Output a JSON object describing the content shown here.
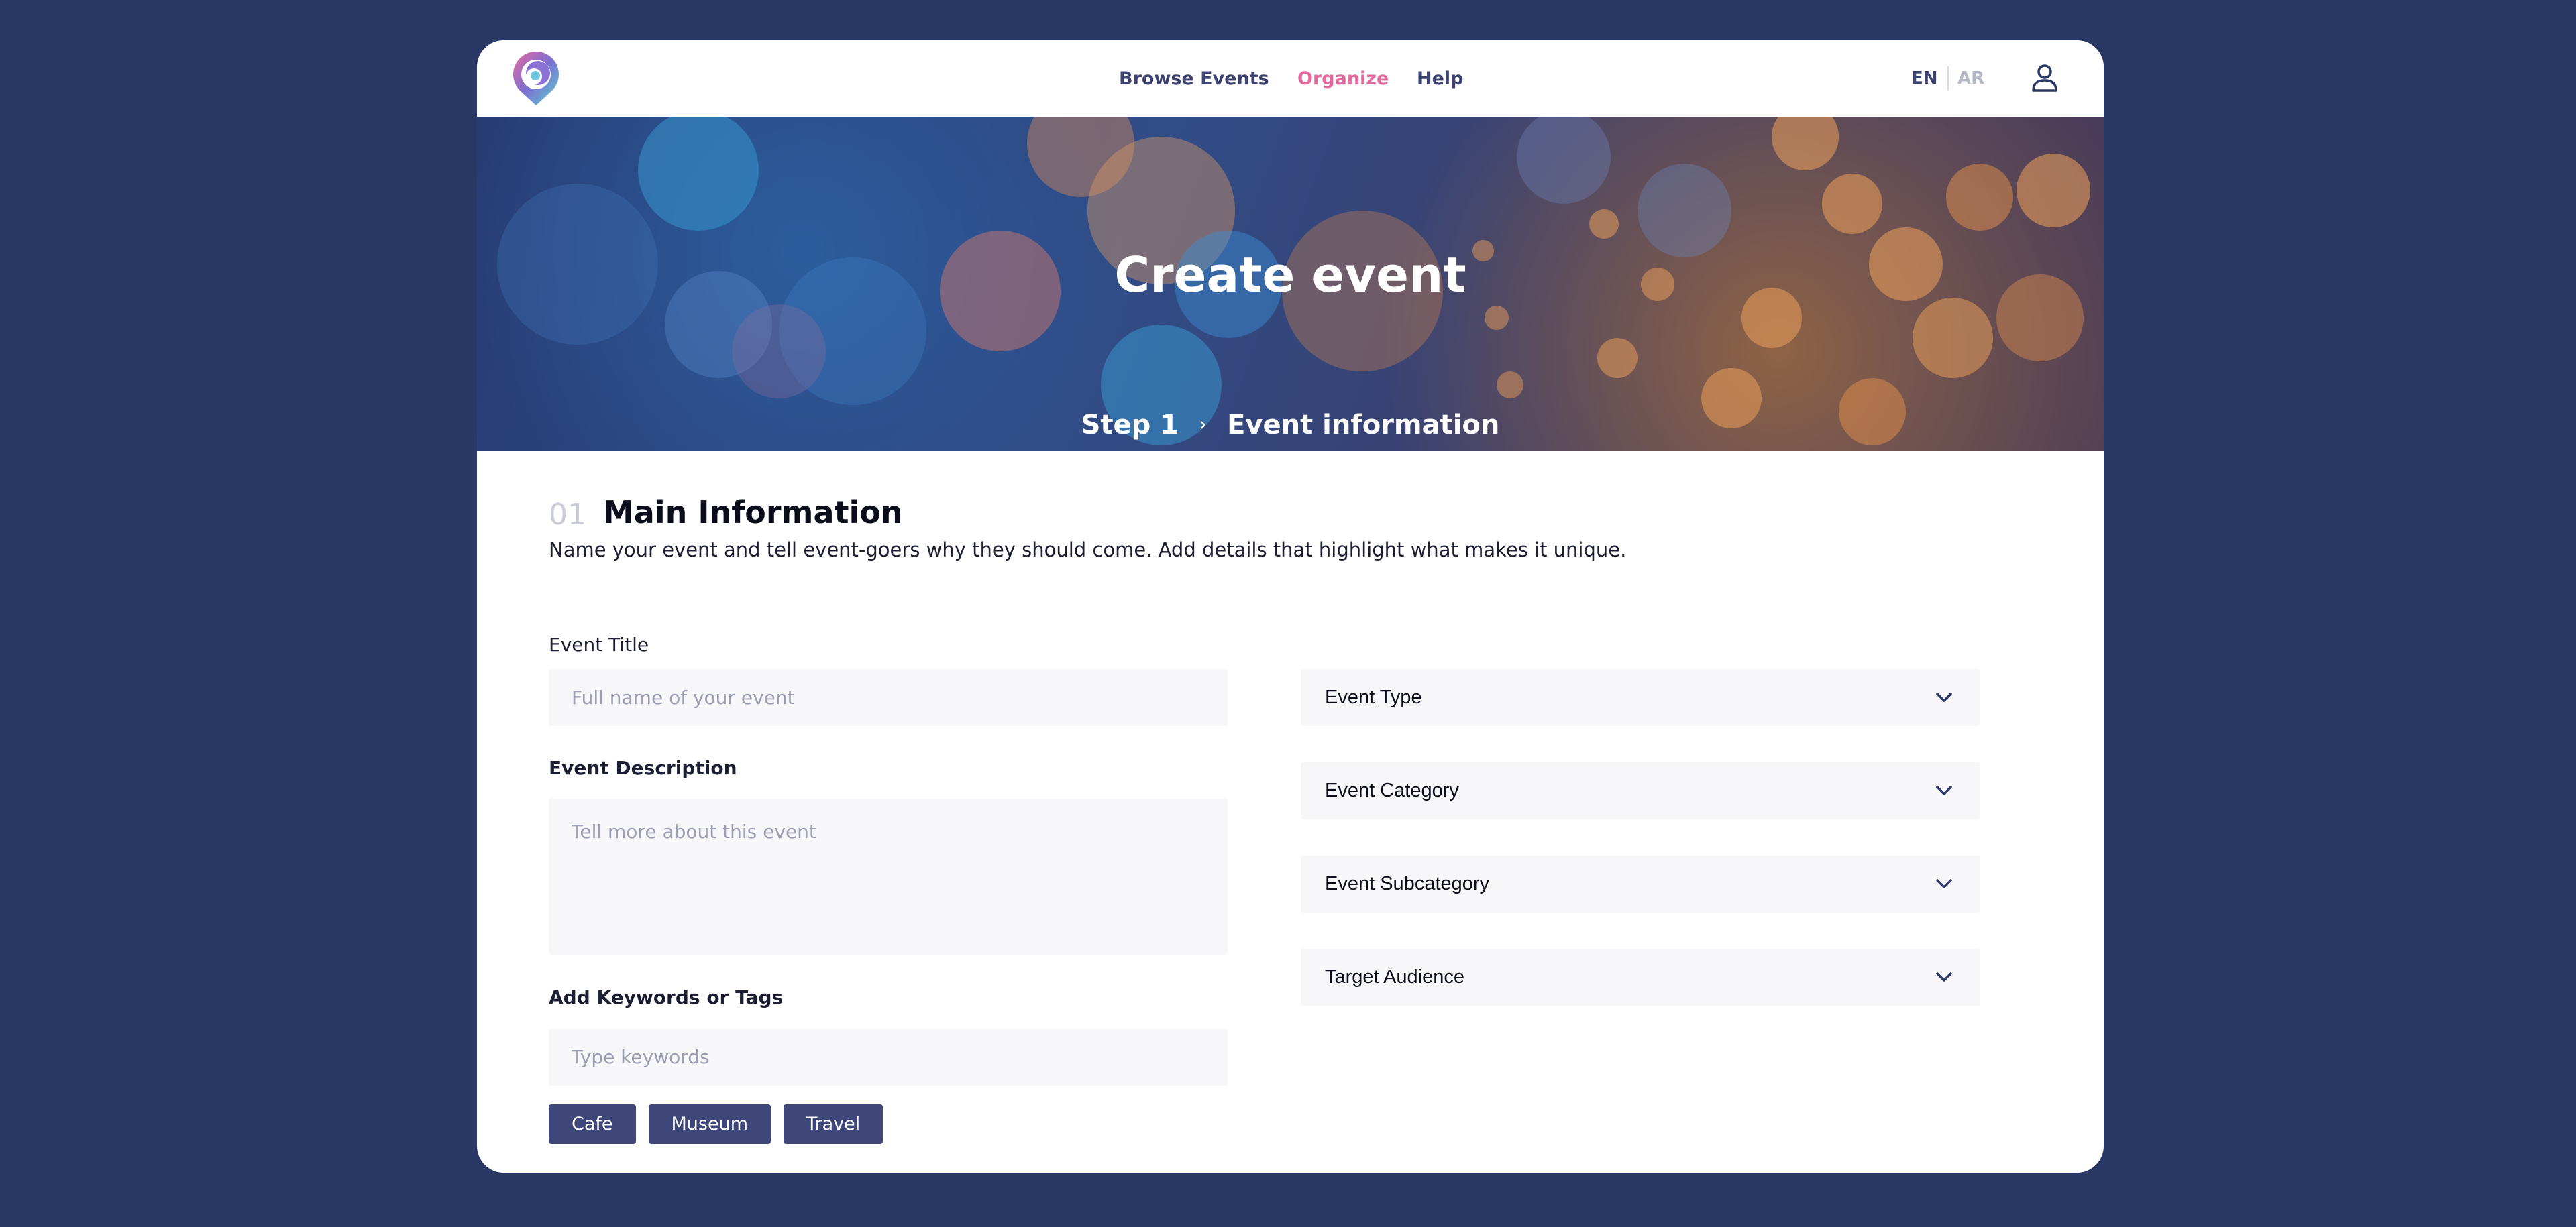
{
  "header": {
    "nav": {
      "browse_events": "Browse Events",
      "organize": "Organize",
      "help": "Help"
    },
    "lang": {
      "en": "EN",
      "ar": "AR"
    }
  },
  "hero": {
    "title": "Create event",
    "step": "Step 1",
    "step_name": "Event information"
  },
  "section": {
    "number": "01",
    "title": "Main Information",
    "description": "Name your event and tell event-goers why they should come. Add details that highlight what makes it unique."
  },
  "form": {
    "event_title_label": "Event Title",
    "event_title_placeholder": "Full name of your event",
    "event_description_label": "Event Description",
    "event_description_placeholder": "Tell more about this event",
    "keywords_label": "Add Keywords or Tags",
    "keywords_placeholder": "Type keywords",
    "tags": [
      "Cafe",
      "Museum",
      "Travel"
    ],
    "selects": {
      "event_type": "Event Type",
      "event_category": "Event Category",
      "event_subcategory": "Event Subcategory",
      "target_audience": "Target Audience"
    }
  },
  "colors": {
    "background": "#2a3866",
    "accent": "#e2689e",
    "nav_text": "#3b4171",
    "tag_bg": "#3f467a"
  },
  "icons": {
    "logo": "location-pin-logo-icon",
    "user": "user-icon",
    "dropdown": "chevron-down-icon",
    "breadcrumb": "chevron-right-icon"
  }
}
